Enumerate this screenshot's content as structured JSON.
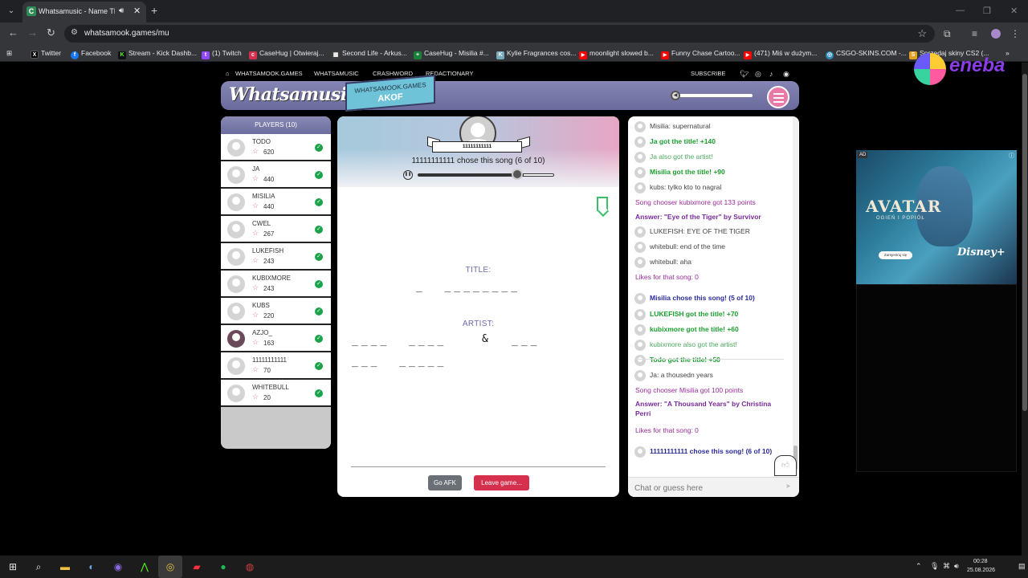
{
  "browser": {
    "tab_title": "Whatsamusic - Name That",
    "tab_favicon": "C",
    "url": "whatsamook.games/mu",
    "bookmarks": [
      {
        "label": "Twitter",
        "icon": "X",
        "color": "#000000"
      },
      {
        "label": "Facebook",
        "icon": "f",
        "color": "#1877f2"
      },
      {
        "label": "Stream - Kick Dashb...",
        "icon": "K",
        "color": "#53fc18"
      },
      {
        "label": "(1) Twitch",
        "icon": "t",
        "color": "#9146ff"
      },
      {
        "label": "CaseHug | Otwieraj...",
        "icon": "c",
        "color": "#d6304f"
      },
      {
        "label": "Second Life - Arkus...",
        "icon": "▦",
        "color": "#3b3b3b"
      },
      {
        "label": "CaseHug - Misilia #...",
        "icon": "+",
        "color": "#188038"
      },
      {
        "label": "Kylie Fragrances cos...",
        "icon": "K",
        "color": "#7ab"
      },
      {
        "label": "moonlight slowed b...",
        "icon": "▶",
        "color": "#ff0000"
      },
      {
        "label": "Funny Chase Cartoo...",
        "icon": "▶",
        "color": "#ff0000"
      },
      {
        "label": "(471) Miś w dużym...",
        "icon": "▶",
        "color": "#ff0000"
      },
      {
        "label": "CSGO-SKINS.COM -...",
        "icon": "◎",
        "color": "#2b8ab8"
      },
      {
        "label": "Sprzedaj skiny CS2 (...",
        "icon": "S",
        "color": "#e0a020"
      }
    ]
  },
  "site": {
    "nav": [
      "WHATSAMOOK.GAMES",
      "WHATSAMUSIC",
      "CRASHWORD",
      "REDACTIONARY"
    ],
    "subscribe": "SUBSCRIBE",
    "logo": "Whatsamusic",
    "game_badge_sub": "WHATSAMOOK.GAMES",
    "game_code": "AKOF"
  },
  "players": {
    "header": "PLAYERS (10)",
    "list": [
      {
        "name": "TODO",
        "points": "620"
      },
      {
        "name": "JA",
        "points": "440"
      },
      {
        "name": "MISILIA",
        "points": "440"
      },
      {
        "name": "CWEL",
        "points": "267"
      },
      {
        "name": "LUKEFISH",
        "points": "243"
      },
      {
        "name": "KUBIXMORE",
        "points": "243"
      },
      {
        "name": "KUBS",
        "points": "220"
      },
      {
        "name": "AZJO_",
        "points": "163"
      },
      {
        "name": "11111111111",
        "points": "70"
      },
      {
        "name": "WHITEBULL",
        "points": "20"
      }
    ]
  },
  "game": {
    "chooser_name": "11111111111",
    "chose_text": "11111111111 chose this song (6 of 10)",
    "progress": 0.78,
    "title_label": "TITLE:",
    "title_blanks_1": "_  ________",
    "artist_label": "ARTIST:",
    "artist_blanks_1": "____  ____",
    "artist_amp": "&",
    "artist_blanks_2": "___",
    "artist_blanks_3": "___  _____",
    "afk_button": "Go AFK",
    "leave_button": "Leave game..."
  },
  "chat": {
    "messages": [
      {
        "text": "Misilia: supernatural",
        "style": "plain",
        "avatar": true
      },
      {
        "text": "Ja got the title! +140",
        "style": "green",
        "avatar": true
      },
      {
        "text": "Ja also got the artist!",
        "style": "lightgreen",
        "avatar": true
      },
      {
        "text": "Misilia got the title! +90",
        "style": "green",
        "avatar": true
      },
      {
        "text": "kubs: tylko kto to nagral",
        "style": "plain",
        "avatar": true
      },
      {
        "text": "Song chooser kubixmore got 133 points",
        "style": "purple",
        "avatar": false
      },
      {
        "text": "Answer: \"Eye of the Tiger\" by Survivor",
        "style": "purpleb",
        "avatar": false
      },
      {
        "text": "LUKEFISH: EYE OF THE TIGER",
        "style": "plain",
        "avatar": true
      },
      {
        "text": "whitebull: end of the time",
        "style": "plain",
        "avatar": true
      },
      {
        "text": "whitebull: aha",
        "style": "plain",
        "avatar": true
      },
      {
        "text": "Likes for that song: 0",
        "style": "purple",
        "avatar": false
      },
      {
        "text": "Misilia chose this song! (5 of 10)",
        "style": "navy",
        "avatar": true
      },
      {
        "text": "LUKEFISH got the title! +70",
        "style": "green",
        "avatar": true
      },
      {
        "text": "kubixmore got the title! +60",
        "style": "green",
        "avatar": true
      },
      {
        "text": "kubixmore also got the artist!",
        "style": "lightgreen",
        "avatar": true
      },
      {
        "text": "Todo got the title! +50",
        "style": "green",
        "avatar": true
      },
      {
        "text": "Ja: a thousedn years",
        "style": "plain",
        "avatar": true
      },
      {
        "text": "Song chooser Misilia got 100 points",
        "style": "purple",
        "avatar": false
      },
      {
        "text": "Answer: \"A Thousand Years\" by Christina Perri",
        "style": "purpleb",
        "avatar": false
      },
      {
        "text": "Likes for that song: 0",
        "style": "purple",
        "avatar": false
      },
      {
        "text": "11111111111 chose this song! (6 of 10)",
        "style": "navy",
        "avatar": true
      }
    ],
    "input_placeholder": "Chat or guess here"
  },
  "ad": {
    "tag": "AD",
    "title": "AVATAR",
    "subtitle": "OGIEŃ I POPIÓŁ",
    "cta": "Zarejestruj się",
    "brand": "Disney+",
    "sponsor": "eneba"
  },
  "taskbar": {
    "time": "00:28",
    "date": "25.08.2026"
  }
}
